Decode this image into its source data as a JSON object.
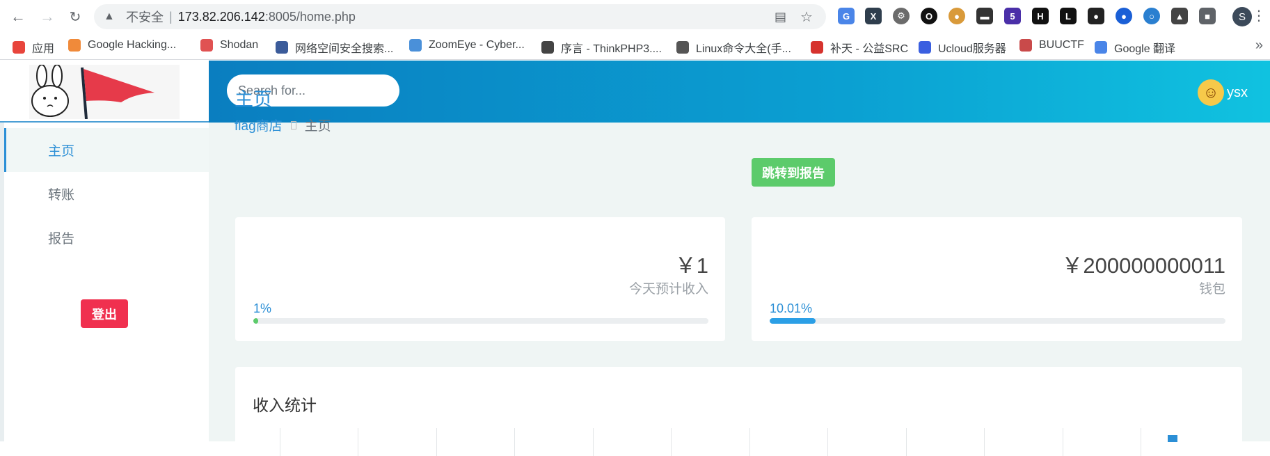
{
  "browser": {
    "insecure_label": "不安全",
    "url_host": "173.82.206.142",
    "url_rest": ":8005/home.php",
    "profile_initial": "S"
  },
  "bookmarks": [
    {
      "label": "应用",
      "color": "#e8453c"
    },
    {
      "label": "Google Hacking...",
      "color": "#f08a3a"
    },
    {
      "label": "Shodan",
      "color": "#e05252"
    },
    {
      "label": "网络空间安全搜索...",
      "color": "#3b5b9a"
    },
    {
      "label": "ZoomEye - Cyber...",
      "color": "#4a90d9"
    },
    {
      "label": "序言 - ThinkPHP3....",
      "color": "#444444"
    },
    {
      "label": "Linux命令大全(手...",
      "color": "#555555"
    },
    {
      "label": "补天 - 公益SRC",
      "color": "#d6332e"
    },
    {
      "label": "Ucloud服务器",
      "color": "#3a5fe0"
    },
    {
      "label": "BUUCTF",
      "color": "#c94a4a"
    },
    {
      "label": "Google 翻译",
      "color": "#4a85e8"
    }
  ],
  "header": {
    "search_placeholder": "Search for...",
    "username": "ysx"
  },
  "sidebar": {
    "items": [
      {
        "label": "主页"
      },
      {
        "label": "转账"
      },
      {
        "label": "报告"
      }
    ],
    "logout_label": "登出"
  },
  "main": {
    "title": "主页",
    "breadcrumb_root": "flag商店",
    "breadcrumb_current": "主页",
    "jump_button": "跳转到报告",
    "cards": [
      {
        "value": "￥1",
        "label": "今天预计收入",
        "percent_text": "1%",
        "percent": 1,
        "color": "#5ccb6b"
      },
      {
        "value": "￥200000000011",
        "label": "钱包",
        "percent_text": "10.01%",
        "percent": 10.01,
        "color": "#2b9fe6"
      }
    ],
    "stats_title": "收入统计"
  },
  "colors": {
    "accent": "#2b8fd6",
    "success": "#5ccb6b",
    "danger": "#f0304f"
  }
}
